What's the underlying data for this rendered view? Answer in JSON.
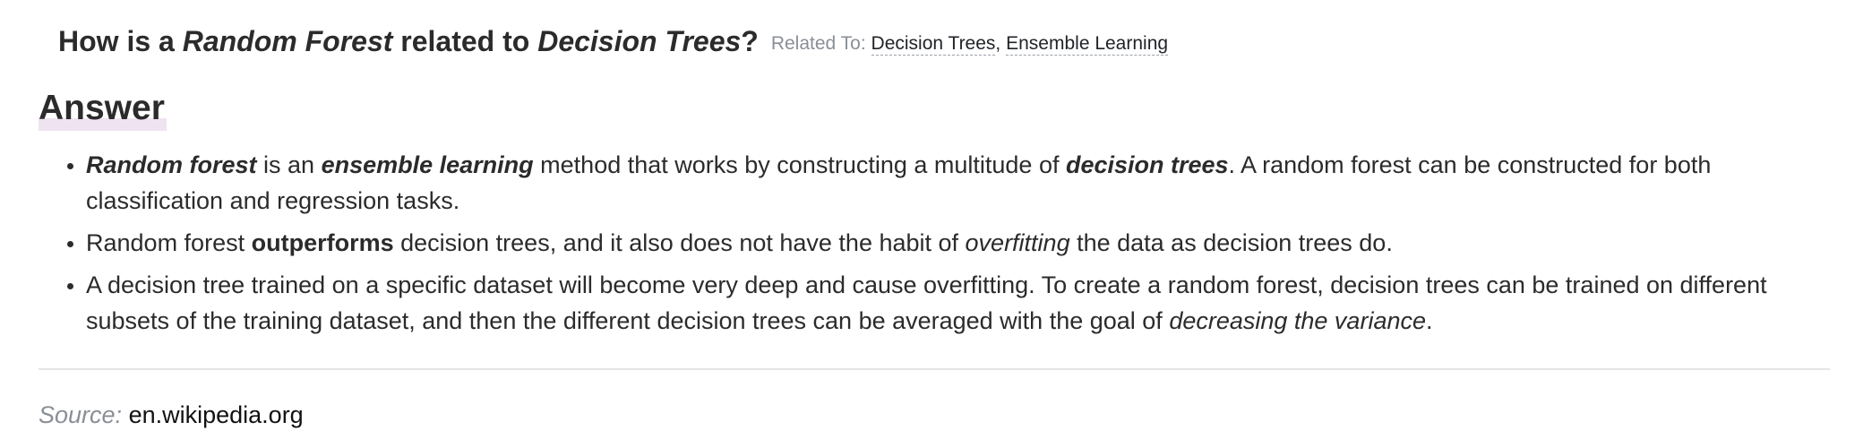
{
  "question": {
    "prefix": "How is a ",
    "term1": "Random Forest",
    "middle": " related to ",
    "term2": "Decision Trees",
    "suffix": "?",
    "related_label": "Related To:",
    "related_links": [
      "Decision Trees",
      "Ensemble Learning"
    ],
    "related_separator": ","
  },
  "answer": {
    "heading": "Answer",
    "points": [
      {
        "a_strong_em": "Random forest",
        "b": " is an ",
        "c_strong_em": "ensemble learning",
        "d": " method that works by constructing a multitude of ",
        "e_strong_em": "decision trees",
        "f": ". A random forest can be constructed for both classification and regression tasks."
      },
      {
        "a": "Random forest ",
        "b_strong": "outperforms",
        "c": " decision trees, and it also does not have the habit of ",
        "d_em": "overfitting",
        "e": " the data as decision trees do."
      },
      {
        "a": "A decision tree trained on a specific dataset will become very deep and cause overfitting. To create a random forest, decision trees can be trained on different subsets of the training dataset, and then the different decision trees can be averaged with the goal of ",
        "b_em": "decreasing the variance",
        "c": "."
      }
    ]
  },
  "source": {
    "label": "Source:",
    "link": "en.wikipedia.org"
  },
  "colors": {
    "text": "#2b2b2b",
    "muted": "#8a8f96",
    "heading_highlight": "#efe3f1",
    "divider": "#e4e4e4"
  }
}
